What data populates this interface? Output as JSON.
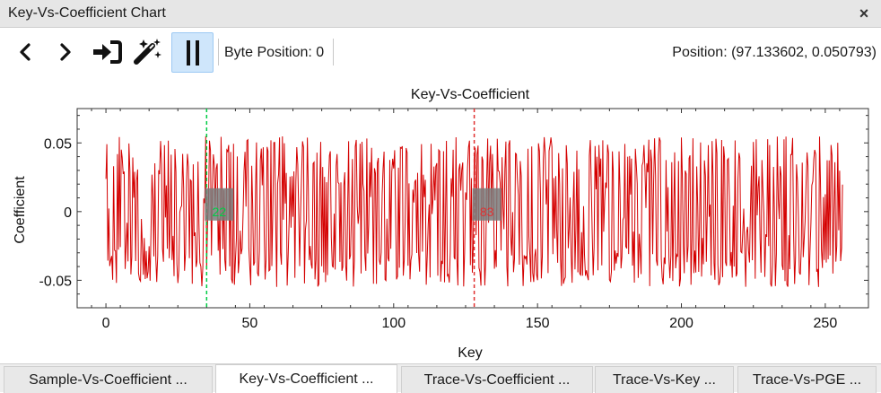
{
  "window": {
    "title": "Key-Vs-Coefficient Chart",
    "close_label": "×"
  },
  "toolbar": {
    "buttons": [
      {
        "name": "previous-button",
        "icon": "chevron-left-icon"
      },
      {
        "name": "next-button",
        "icon": "chevron-right-icon"
      },
      {
        "name": "import-button",
        "icon": "sign-in-icon"
      },
      {
        "name": "magic-wand-button",
        "icon": "magic-wand-icon"
      },
      {
        "name": "pause-button",
        "icon": "pause-icon",
        "active": true
      }
    ],
    "byte_position_label": "Byte Position: 0",
    "position_readout": "Position: (97.133602, 0.050793)"
  },
  "chart_data": {
    "type": "line",
    "title": "Key-Vs-Coefficient",
    "xlabel": "Key",
    "ylabel": "Coefficient",
    "xlim": [
      -10,
      265
    ],
    "ylim": [
      -0.07,
      0.075
    ],
    "xticks": [
      0,
      50,
      100,
      150,
      200,
      250
    ],
    "xtick_labels": [
      "0",
      "50",
      "100",
      "150",
      "200",
      "250"
    ],
    "yticks": [
      -0.05,
      0,
      0.05
    ],
    "ytick_labels": [
      "-0.05",
      "0",
      "0.05"
    ],
    "series_color": "#d40000",
    "markers": [
      {
        "key": 35,
        "color": "#00cc44",
        "label": "22"
      },
      {
        "key": 128,
        "color": "#e03030",
        "label": "83"
      }
    ],
    "seed": 22,
    "keys": 256
  },
  "tabs": [
    {
      "label": "Sample-Vs-Coefficient ...",
      "active": false
    },
    {
      "label": "Key-Vs-Coefficient ...",
      "active": true
    },
    {
      "label": "Trace-Vs-Coefficient ...",
      "active": false
    },
    {
      "label": "Trace-Vs-Key ...",
      "active": false
    },
    {
      "label": "Trace-Vs-PGE ...",
      "active": false
    }
  ]
}
